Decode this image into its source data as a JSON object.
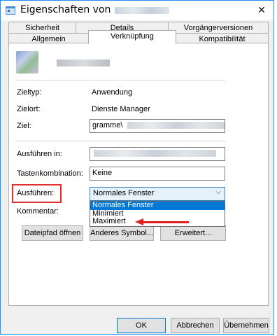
{
  "window": {
    "title": "Eigenschaften von",
    "close_glyph": "✕"
  },
  "tabs": {
    "row1": [
      {
        "label": "Sicherheit"
      },
      {
        "label": "Details"
      },
      {
        "label": "Vorgängerversionen"
      }
    ],
    "row2": [
      {
        "label": "Allgemein"
      },
      {
        "label": "Verknüpfung",
        "active": true
      },
      {
        "label": "Kompatibilität"
      }
    ]
  },
  "shortcut": {
    "icon": "app-icon",
    "zieltyp_label": "Zieltyp:",
    "zieltyp_value": "Anwendung",
    "zielort_label": "Zielort:",
    "zielort_value": "Dienste Manager",
    "ziel_label": "Ziel:",
    "ziel_value": "gramme\\",
    "ausfuehren_in_label": "Ausführen in:",
    "tastenkombination_label": "Tastenkombination:",
    "tastenkombination_value": "Keine",
    "ausfuehren_label": "Ausführen:",
    "ausfuehren_value": "Normales Fenster",
    "ausfuehren_options": [
      "Normales Fenster",
      "Minimiert",
      "Maximiert"
    ],
    "kommentar_label": "Kommentar:"
  },
  "buttons": {
    "dateipfad": "Dateipfad öffnen",
    "symbol": "Anderes Symbol...",
    "erweitert": "Erweitert...",
    "ok": "OK",
    "abbrechen": "Abbrechen",
    "uebernehmen": "Übernehmen"
  },
  "annotation_color": "#e03030"
}
